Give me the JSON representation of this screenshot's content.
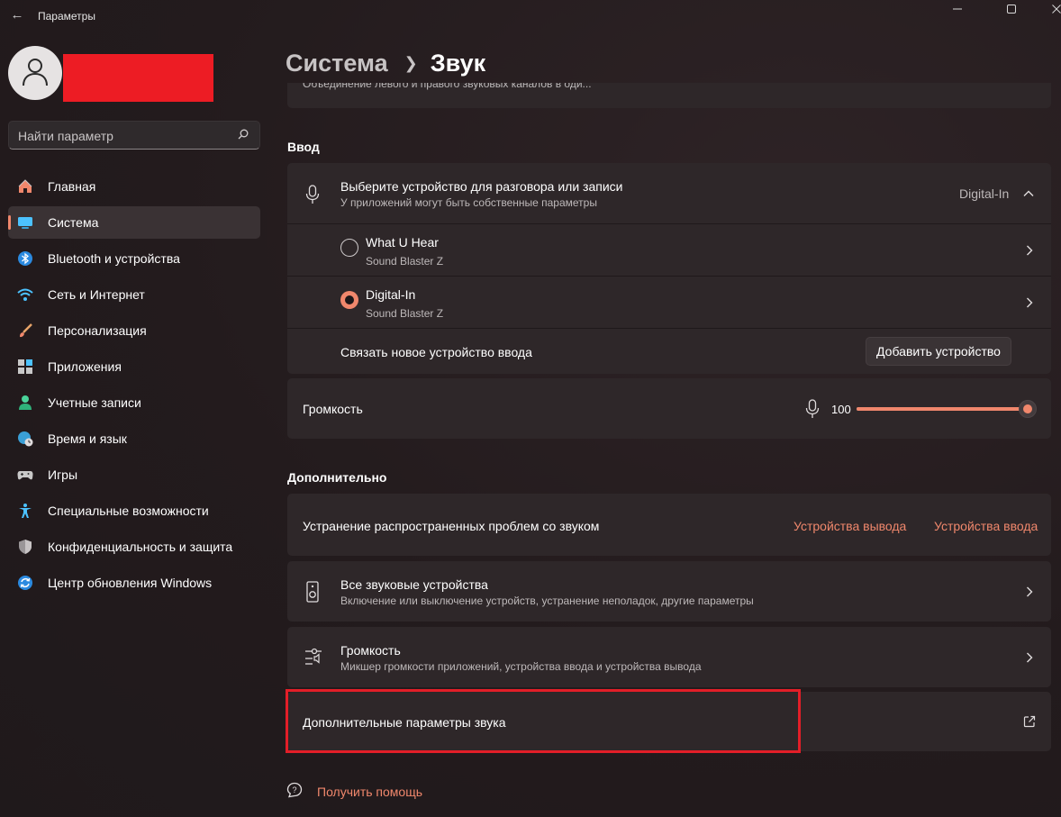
{
  "window": {
    "title": "Параметры"
  },
  "sidebar": {
    "search_placeholder": "Найти параметр",
    "items": [
      {
        "label": "Главная",
        "icon": "home-icon",
        "active": false
      },
      {
        "label": "Система",
        "icon": "system-icon",
        "active": true
      },
      {
        "label": "Bluetooth и устройства",
        "icon": "bluetooth-icon",
        "active": false
      },
      {
        "label": "Сеть и Интернет",
        "icon": "wifi-icon",
        "active": false
      },
      {
        "label": "Персонализация",
        "icon": "brush-icon",
        "active": false
      },
      {
        "label": "Приложения",
        "icon": "apps-icon",
        "active": false
      },
      {
        "label": "Учетные записи",
        "icon": "account-icon",
        "active": false
      },
      {
        "label": "Время и язык",
        "icon": "globe-clock-icon",
        "active": false
      },
      {
        "label": "Игры",
        "icon": "gamepad-icon",
        "active": false
      },
      {
        "label": "Специальные возможности",
        "icon": "accessibility-icon",
        "active": false
      },
      {
        "label": "Конфиденциальность и защита",
        "icon": "shield-icon",
        "active": false
      },
      {
        "label": "Центр обновления Windows",
        "icon": "update-icon",
        "active": false
      }
    ]
  },
  "header": {
    "parent": "Система",
    "current": "Звук"
  },
  "top_fragment": "Объединение левого и правого звуковых каналов в оди...",
  "input_section": {
    "title": "Ввод",
    "device_select": {
      "title": "Выберите устройство для разговора или записи",
      "subtitle": "У приложений могут быть собственные параметры",
      "current": "Digital-In"
    },
    "devices": [
      {
        "name": "What U Hear",
        "sub": "Sound Blaster Z",
        "selected": false
      },
      {
        "name": "Digital-In",
        "sub": "Sound Blaster Z",
        "selected": true
      }
    ],
    "pair_label": "Связать новое устройство ввода",
    "add_button": "Добавить устройство",
    "volume": {
      "label": "Громкость",
      "value": "100",
      "level": 1.0
    }
  },
  "advanced_section": {
    "title": "Дополнительно",
    "troubleshoot": {
      "label": "Устранение распространенных проблем со звуком",
      "link_output": "Устройства вывода",
      "link_input": "Устройства ввода"
    },
    "all_devices": {
      "title": "Все звуковые устройства",
      "subtitle": "Включение или выключение устройств, устранение неполадок, другие параметры"
    },
    "volume_mixer": {
      "title": "Громкость",
      "subtitle": "Микшер громкости приложений, устройства ввода и устройства вывода"
    },
    "more_settings": {
      "label": "Дополнительные параметры звука"
    }
  },
  "help_link": "Получить помощь",
  "colors": {
    "accent": "#f0876c",
    "highlight": "#e31e28",
    "redaction": "#ed1c24"
  }
}
